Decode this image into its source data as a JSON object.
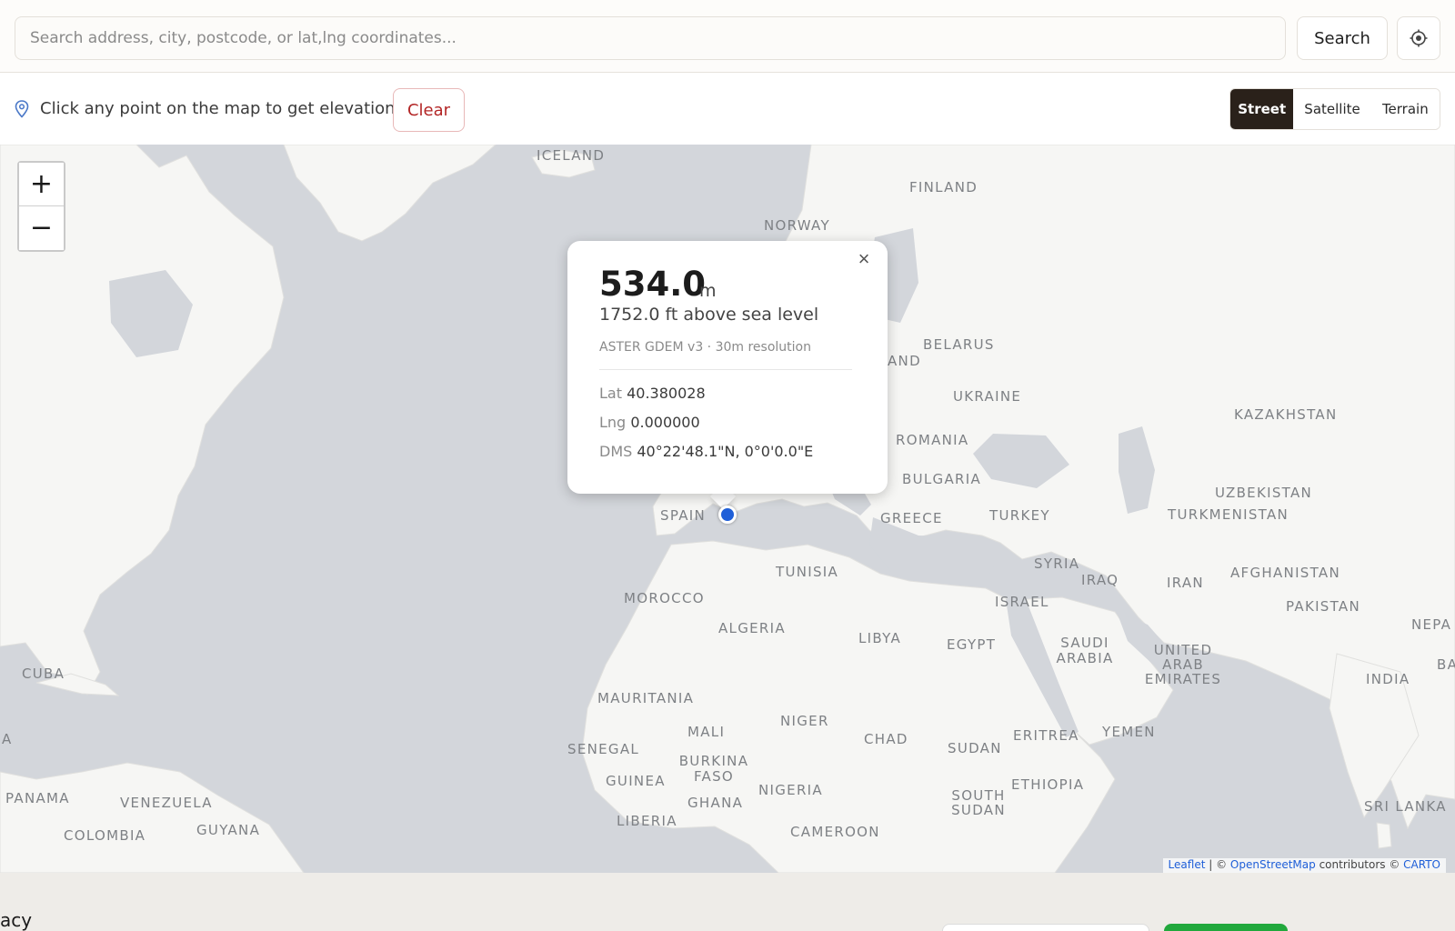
{
  "search": {
    "placeholder": "Search address, city, postcode, or lat,lng coordinates...",
    "button_label": "Search",
    "locate_icon": "locate-icon"
  },
  "toolbar": {
    "hint_icon": "map-pin-icon",
    "hint": "Click any point on the map to get elevation",
    "clear_label": "Clear",
    "layers": {
      "street": "Street",
      "satellite": "Satellite",
      "terrain": "Terrain",
      "active": "Street"
    }
  },
  "map": {
    "zoom_in": "+",
    "zoom_out": "−",
    "labels": {
      "iceland": "ICELAND",
      "finland": "FINLAND",
      "norway": "NORWAY",
      "belarus": "BELARUS",
      "and": "AND",
      "ukraine": "UKRAINE",
      "kazakhstan": "KAZAKHSTAN",
      "romania": "ROMANIA",
      "bulgaria": "BULGARIA",
      "uzbekistan": "UZBEKISTAN",
      "spain": "SPAIN",
      "greece": "GREECE",
      "turkey": "TURKEY",
      "turkmenistan": "TURKMENISTAN",
      "tunisia": "TUNISIA",
      "syria": "SYRIA",
      "iraq": "IRAQ",
      "iran": "IRAN",
      "afghanistan": "AFGHANISTAN",
      "morocco": "MOROCCO",
      "israel": "ISRAEL",
      "pakistan": "PAKISTAN",
      "nepal": "NEPA",
      "algeria": "ALGERIA",
      "libya": "LIBYA",
      "egypt": "EGYPT",
      "saudi_arabia": "SAUDI ARABIA",
      "uae": "UNITED ARAB EMIRATES",
      "bangladesh": "BA",
      "cuba": "CUBA",
      "india": "INDIA",
      "mauritania": "MAURITANIA",
      "niger": "NIGER",
      "mali": "MALI",
      "chad": "CHAD",
      "sudan": "SUDAN",
      "eritrea": "ERITREA",
      "yemen": "YEMEN",
      "edge_a": "A",
      "senegal": "SENEGAL",
      "burkina_faso": "BURKINA FASO",
      "guinea": "GUINEA",
      "nigeria": "NIGERIA",
      "ethiopia": "ETHIOPIA",
      "panama": "PANAMA",
      "venezuela": "VENEZUELA",
      "ghana": "GHANA",
      "south_sudan": "SOUTH SUDAN",
      "sri_lanka": "SRI LANKA",
      "guyana": "GUYANA",
      "colombia": "COLOMBIA",
      "liberia": "LIBERIA",
      "cameroon": "CAMEROON"
    },
    "attribution": {
      "leaflet": "Leaflet",
      "separator": " | © ",
      "osm": "OpenStreetMap",
      "contributors": " contributors © ",
      "carto": "CARTO"
    }
  },
  "popup": {
    "elevation": "534.0",
    "unit": "m",
    "feet": "1752.0 ft above sea level",
    "source": "ASTER GDEM v3 · 30m resolution",
    "lat_label": "Lat",
    "lat": "40.380028",
    "lng_label": "Lng",
    "lng": "0.000000",
    "dms_label": "DMS",
    "dms": "40°22'48.1\"N, 0°0'0.0\"E",
    "close": "×"
  },
  "footer": {
    "text": "acy"
  },
  "colors": {
    "water": "#d3d6db",
    "land": "#f6f6f4",
    "marker": "#1f5fd8",
    "clear": "#b32626",
    "active_layer": "#2a211a",
    "footer_green": "#21a83c"
  }
}
